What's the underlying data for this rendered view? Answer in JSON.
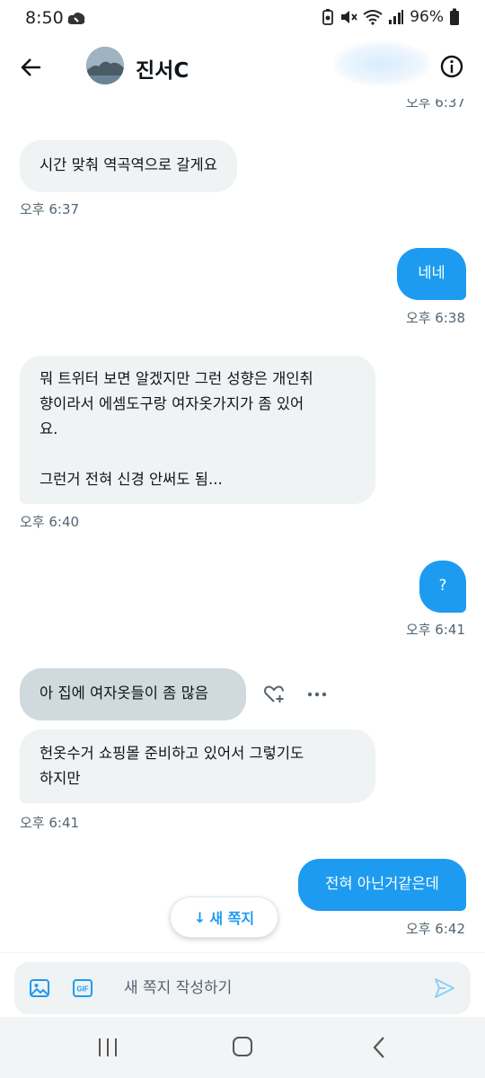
{
  "status_bar": {
    "time": "8:50",
    "battery": "96%"
  },
  "header": {
    "contact_name": "진서C"
  },
  "messages": [
    {
      "dir": "out",
      "time": "오후 6:37"
    },
    {
      "dir": "in",
      "text": "시간 맞춰 역곡역으로 갈게요",
      "time": "오후 6:37"
    },
    {
      "dir": "out",
      "text": "네네",
      "time": "오후 6:38"
    },
    {
      "dir": "in",
      "lines": [
        "뭐 트위터 보면 알겠지만 그런 성향은 개인취",
        "향이라서  에셈도구랑 여자옷가지가 좀 있어",
        "요.",
        "",
        "그런거 전혀 신경 안써도 됨..."
      ],
      "time": "오후 6:40"
    },
    {
      "dir": "out",
      "text": "?",
      "time": "오후 6:41"
    },
    {
      "dir": "in",
      "text": "아 집에 여자옷들이 좀 많음"
    },
    {
      "dir": "in",
      "lines": [
        "헌옷수거 쇼핑몰 준비하고 있어서 그렇기도",
        "하지만"
      ],
      "time": "오후 6:41"
    },
    {
      "dir": "out",
      "text": "전혀 아닌거같은데",
      "time": "오후 6:42"
    }
  ],
  "new_message_pill": {
    "arrow": "↓",
    "label": "새 쪽지"
  },
  "composer": {
    "placeholder": "새 쪽지 작성하기",
    "value": "",
    "gif_label": "GIF"
  },
  "colors": {
    "accent": "#1d9bf0",
    "incoming_bubble": "#eff3f4",
    "selected_bubble": "#cfd9de",
    "timestamp": "#536471"
  },
  "icons": {
    "back": "arrow-left-icon",
    "info": "info-icon",
    "react": "heart-plus-icon",
    "more": "more-horizontal-icon",
    "image": "image-icon",
    "gif": "gif-icon",
    "send": "send-icon"
  }
}
